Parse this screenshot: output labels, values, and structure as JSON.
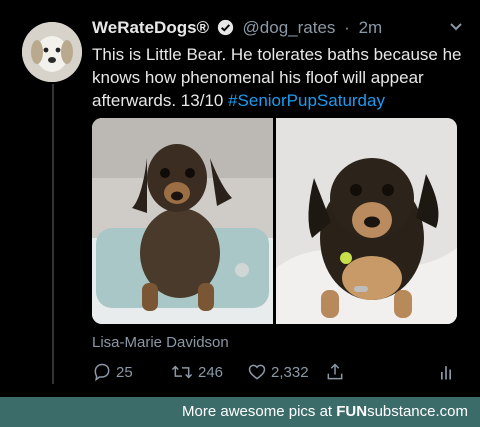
{
  "tweet": {
    "display_name": "WeRateDogs®",
    "handle": "@dog_rates",
    "separator": "·",
    "time": "2m",
    "text_main": "This is Little Bear. He tolerates baths because he knows how phenomenal his floof will appear afterwards. 13/10 ",
    "hashtag": "#SeniorPupSaturday",
    "photo_credit": "Lisa-Marie Davidson",
    "media": [
      {
        "subject": "wet dachshund mix in bathtub"
      },
      {
        "subject": "fluffy dachshund mix on bed"
      }
    ]
  },
  "actions": {
    "replies": "25",
    "retweets": "246",
    "likes": "2,332"
  },
  "banner": {
    "prefix": "More awesome pics at ",
    "brand_part1": "FUN",
    "brand_part2": "substance",
    "brand_part3": ".com"
  },
  "colors": {
    "background": "#000000",
    "link": "#1d9bf0",
    "muted": "#8b98a5",
    "banner": "#3c6c6a"
  },
  "icons": [
    "verified-badge-icon",
    "chevron-down-icon",
    "reply-icon",
    "retweet-icon",
    "like-icon",
    "share-icon",
    "analytics-icon"
  ]
}
